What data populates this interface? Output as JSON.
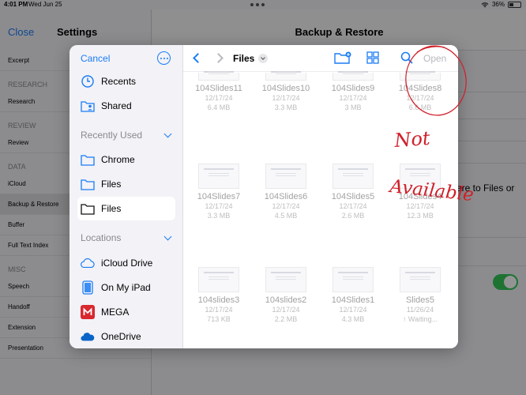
{
  "status_bar": {
    "time": "4:01 PM",
    "date": "Wed Jun 25",
    "battery": "36%"
  },
  "settings_app": {
    "close_label": "Close",
    "title": "Settings",
    "detail_title": "Backup & Restore",
    "share_partial": "are to Files or",
    "sidebar": [
      {
        "type": "item",
        "label": "Excerpt"
      },
      {
        "type": "section",
        "label": "RESEARCH"
      },
      {
        "type": "item",
        "label": "Research"
      },
      {
        "type": "section",
        "label": "REVIEW"
      },
      {
        "type": "item",
        "label": "Review"
      },
      {
        "type": "section",
        "label": "DATA"
      },
      {
        "type": "item",
        "label": "iCloud"
      },
      {
        "type": "item",
        "label": "Backup & Restore",
        "active": true
      },
      {
        "type": "item",
        "label": "Buffer"
      },
      {
        "type": "item",
        "label": "Full Text Index"
      },
      {
        "type": "section",
        "label": "MISC"
      },
      {
        "type": "item",
        "label": "Speech"
      },
      {
        "type": "item",
        "label": "Handoff"
      },
      {
        "type": "item",
        "label": "Extension"
      },
      {
        "type": "item",
        "label": "Presentation"
      }
    ]
  },
  "picker": {
    "cancel_label": "Cancel",
    "location_title": "Files",
    "open_label": "Open",
    "favorites": [
      {
        "label": "Recents",
        "icon": "clock-icon"
      },
      {
        "label": "Shared",
        "icon": "shared-folder-icon"
      }
    ],
    "recently_used_header": "Recently Used",
    "recently_used": [
      {
        "label": "Chrome",
        "icon": "folder-icon"
      },
      {
        "label": "Files",
        "icon": "folder-icon"
      },
      {
        "label": "Files",
        "icon": "folder-icon",
        "selected": true
      }
    ],
    "locations_header": "Locations",
    "locations": [
      {
        "label": "iCloud Drive",
        "icon": "icloud-icon"
      },
      {
        "label": "On My iPad",
        "icon": "ipad-icon"
      },
      {
        "label": "MEGA",
        "icon": "mega-icon"
      },
      {
        "label": "OneDrive",
        "icon": "onedrive-icon"
      }
    ],
    "files": [
      {
        "name": "104Slides11",
        "date": "12/17/24",
        "size": "6.4 MB"
      },
      {
        "name": "104Slides10",
        "date": "12/17/24",
        "size": "3.3 MB"
      },
      {
        "name": "104Slides9",
        "date": "12/17/24",
        "size": "3 MB"
      },
      {
        "name": "104Slides8",
        "date": "12/17/24",
        "size": "6.6 MB"
      },
      {
        "name": "104Slides7",
        "date": "12/17/24",
        "size": "3.3 MB"
      },
      {
        "name": "104Slides6",
        "date": "12/17/24",
        "size": "4.5 MB"
      },
      {
        "name": "104Slides5",
        "date": "12/17/24",
        "size": "2.6 MB"
      },
      {
        "name": "104Slides4",
        "date": "12/17/24",
        "size": "12.3 MB"
      },
      {
        "name": "104slides3",
        "date": "12/17/24",
        "size": "713 KB"
      },
      {
        "name": "104slides2",
        "date": "12/17/24",
        "size": "2.2 MB"
      },
      {
        "name": "104Slides1",
        "date": "12/17/24",
        "size": "4.3 MB"
      },
      {
        "name": "Slides5",
        "date": "11/26/24",
        "size": "↑ Waiting..."
      }
    ]
  },
  "annotation": {
    "line1": "Not",
    "line2": "Available",
    "color": "#d0202a"
  }
}
